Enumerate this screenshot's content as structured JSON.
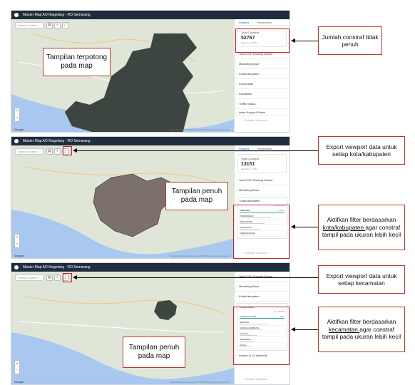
{
  "app_title": "Master Map AO Magelang - RO Semarang",
  "search_placeholder": "Search location",
  "tabs": {
    "widgets": "Widgets",
    "parameters": "Parameters"
  },
  "map_footer": "Keyboard shortcuts   Map data ©2024   Terms   Report a map error",
  "google_logo": "Google",
  "activate_windows": "Activate Windows",
  "panel1": {
    "card_label": "Total Constraf",
    "card_value": "52767",
    "card_sub": "Magelang: 52767",
    "accordions": [
      "Total OOH Gudang Garam",
      "Marketing Asset",
      "Kota/Kabupaten",
      "Kecamatan",
      "Klasifikasi",
      "Traffic Status",
      "Index Buyport Status"
    ]
  },
  "panel2": {
    "card_label": "Total Constraf",
    "card_value": "13151",
    "card_sub": "Magelang: 13151",
    "accordions": [
      "Total OOH Gudang Garam",
      "Marketing Asset"
    ],
    "filter_title": "Kota/Kabupaten",
    "filter_actions": "ALL   NONE",
    "filter_rows": [
      {
        "name": "KEBUMEN",
        "value": "13151"
      },
      {
        "name": "PURWOREJO",
        "value": ""
      },
      {
        "name": "WONOSOBO",
        "value": ""
      },
      {
        "name": "MAGELANG",
        "value": ""
      },
      {
        "name": "TEMANGGUNG",
        "value": ""
      }
    ]
  },
  "panel3": {
    "accordions": [
      "Total OOH Gudang Garam",
      "Marketing Asset",
      "Kota/Kabupaten"
    ],
    "filter_title": "Kecamatan",
    "filter_actions": "ALL   NONE",
    "filter_rows": [
      {
        "name": "KARANGGAYAM",
        "value": "1951"
      },
      {
        "name": "SEMPOR",
        "value": ""
      },
      {
        "name": "KARANGSAMBUNG",
        "value": ""
      },
      {
        "name": "SADANG",
        "value": ""
      },
      {
        "name": "SRUWENG",
        "value": ""
      },
      {
        "name": "Others",
        "value": ""
      }
    ],
    "filter_footer": "Search in 13 elements"
  },
  "annotations": {
    "a1": "Jumlah constraf tidak penuh",
    "a2": "Export viewport data untuk setiap kota/kabupaten",
    "a3_pre": "Aktifkan filter berdasarkan ",
    "a3_u": "kota/kabupaten ",
    "a3_post": "agar constraf tampil pada ukuran lebih kecil",
    "a4": "Export viewport data untuk setiap kecamatan",
    "a5_pre": "Aktifkan filter berdasarkan ",
    "a5_u": "kecamatan ",
    "a5_post": "agar constraf tampil pada ukuran lebih kecil",
    "m1": "Tampilan terpotong pada map",
    "m2": "Tampilan penuh pada map",
    "m3": "Tampilan penuh pada map"
  },
  "colors": {
    "titlebar": "#1f2d3d",
    "accent": "#1a73e8",
    "annotation_border": "#c0392b",
    "highlight": "#d0202a",
    "polygon": "#3d4540"
  }
}
